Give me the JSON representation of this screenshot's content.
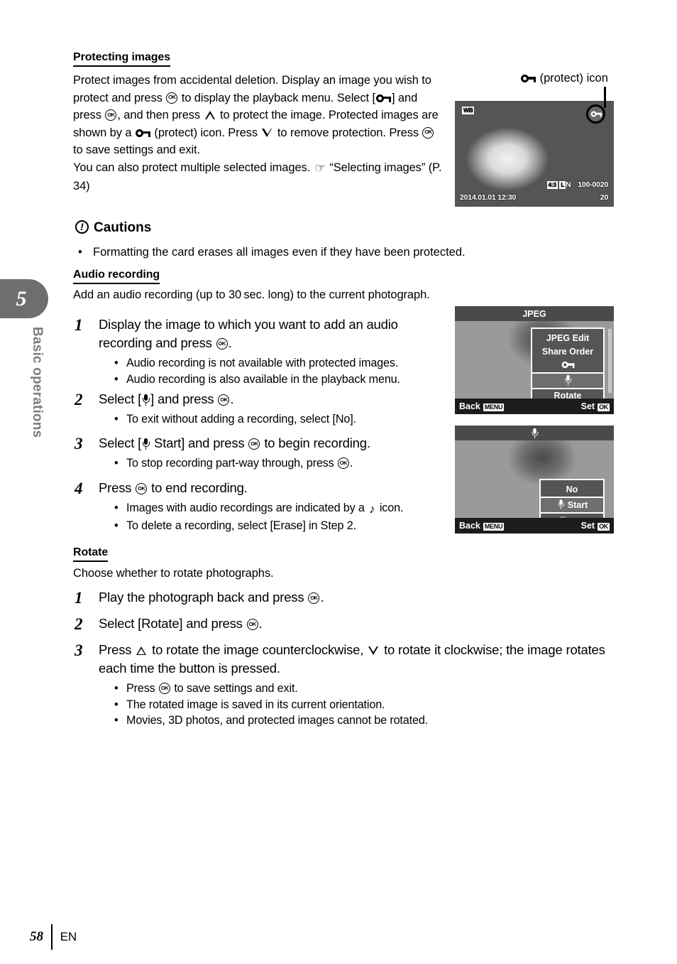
{
  "chapter": {
    "number": "5",
    "label": "Basic operations"
  },
  "footer": {
    "page_number": "58",
    "language": "EN"
  },
  "sections": {
    "protecting": {
      "heading": "Protecting images",
      "paragraph_parts": {
        "p1": "Protect images from accidental deletion. Display an image you wish to protect and press ",
        "p2": " to display the playback menu. Select [",
        "p3": "] and press ",
        "p4": ", and then press ",
        "p5": " to protect the image. Protected images are shown by a ",
        "p6": " (protect) icon. Press ",
        "p7": " to remove protection. Press ",
        "p8": " to save settings and exit.",
        "p9": "You can also protect multiple selected images. ",
        "p10": " “Selecting images” (P. 34)"
      }
    },
    "cautions": {
      "heading": "Cautions",
      "bullets": [
        "Formatting the card erases all images even if they have been protected."
      ]
    },
    "audio_recording": {
      "heading": "Audio recording",
      "intro": "Add an audio recording (up to 30 sec. long) to the current photograph.",
      "steps": [
        {
          "number": "1",
          "text_parts": {
            "a": "Display the image to which you want to add an audio recording and press ",
            "b": "."
          },
          "bullets": [
            "Audio recording is not available with protected images.",
            "Audio recording is also available in the playback menu."
          ]
        },
        {
          "number": "2",
          "text_parts": {
            "a": "Select [",
            "b": "] and press ",
            "c": "."
          },
          "bullets": [
            "To exit without adding a recording, select [No]."
          ]
        },
        {
          "number": "3",
          "text_parts": {
            "a": "Select [",
            "b": " Start] and press ",
            "c": " to begin recording."
          },
          "bullets": [
            "To stop recording part-way through, press "
          ],
          "bullet_suffix": "."
        },
        {
          "number": "4",
          "text_parts": {
            "a": "Press ",
            "b": " to end recording."
          },
          "bullets": [
            "Images with audio recordings are indicated by a ",
            "To delete a recording, select [Erase] in Step 2."
          ],
          "bullet_suffix": " icon."
        }
      ]
    },
    "rotate": {
      "heading": "Rotate",
      "intro": "Choose whether to rotate photographs.",
      "steps": [
        {
          "number": "1",
          "text_parts": {
            "a": "Play the photograph back and press ",
            "b": "."
          }
        },
        {
          "number": "2",
          "text_parts": {
            "a": "Select [Rotate] and press ",
            "b": "."
          }
        },
        {
          "number": "3",
          "text_parts": {
            "a": "Press ",
            "b": " to rotate the image counterclockwise, ",
            "c": " to rotate it clockwise; the image rotates each time the button is pressed."
          },
          "bullets": [
            "Press ",
            "The rotated image is saved in its current orientation.",
            "Movies, 3D photos, and protected images cannot be rotated."
          ],
          "bullet_suffix": " to save settings and exit."
        }
      ]
    }
  },
  "figures": {
    "protect_callout": {
      "label_text": " (protect) icon",
      "icon_name": "protect-key-icon"
    },
    "playback_screen": {
      "wb_chip": "WB",
      "aspect_chip": "4:3",
      "quality_chip": "L",
      "quality_text": "N",
      "file_number": "100-0020",
      "timestamp": "2014.01.01 12:30",
      "frame_number": "20"
    },
    "jpeg_menu_screen": {
      "title": "JPEG",
      "items": [
        {
          "label": "JPEG Edit",
          "selected": false,
          "icon": ""
        },
        {
          "label": "Share Order",
          "selected": false,
          "icon": ""
        },
        {
          "label": "",
          "selected": false,
          "icon": "protect-key-icon"
        },
        {
          "label": "",
          "selected": true,
          "icon": "microphone-icon"
        },
        {
          "label": "Rotate",
          "selected": false,
          "icon": ""
        },
        {
          "label": "",
          "selected": false,
          "icon": "slideshow-icon"
        }
      ],
      "footer_back": "Back",
      "footer_back_key": "MENU",
      "footer_set": "Set",
      "footer_set_key": "OK"
    },
    "audio_menu_screen": {
      "title_icon": "microphone-icon",
      "items": [
        {
          "label": "No",
          "selected": false,
          "dimmed": false,
          "icon": ""
        },
        {
          "label": "Start",
          "selected": true,
          "dimmed": false,
          "icon": "microphone-icon"
        },
        {
          "label": "Erase",
          "selected": false,
          "dimmed": true,
          "icon": ""
        }
      ],
      "footer_back": "Back",
      "footer_back_key": "MENU",
      "footer_set": "Set",
      "footer_set_key": "OK"
    }
  }
}
